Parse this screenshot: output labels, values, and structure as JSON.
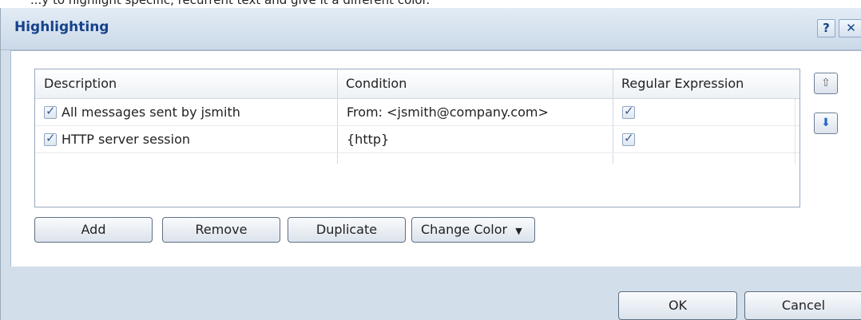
{
  "caption": "...y to highlight specific, recurrent text and give it a different color.",
  "dialog": {
    "title": "Highlighting",
    "help_icon": "question-icon",
    "close_icon": "close-icon"
  },
  "table": {
    "columns": [
      "Description",
      "Condition",
      "Regular Expression"
    ],
    "rows": [
      {
        "enabled": true,
        "description": "All messages sent by jsmith",
        "condition": "From: <jsmith@company.com>",
        "regex": true
      },
      {
        "enabled": true,
        "description": "HTTP server session",
        "condition": "{http}",
        "regex": true
      }
    ]
  },
  "side_buttons": {
    "move_up_icon": "arrow-up-icon",
    "move_down_icon": "arrow-down-icon"
  },
  "actions": {
    "add": "Add",
    "remove": "Remove",
    "duplicate": "Duplicate",
    "change_color": "Change Color",
    "change_color_icon": "caret-down-icon"
  },
  "footer": {
    "ok": "OK",
    "cancel": "Cancel"
  },
  "colors": {
    "title_text": "#15428b",
    "dialog_bg": "#d3deeb",
    "checkbox_tick": "#3a5f92"
  }
}
